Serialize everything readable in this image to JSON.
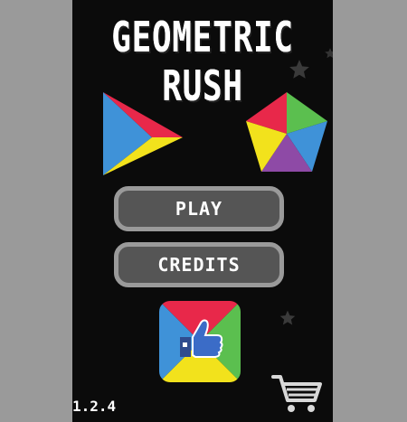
{
  "game": {
    "title_line1": "GEOMETRIC",
    "title_line2": "RUSH",
    "play_label": "PLAY",
    "credits_label": "CREDITS",
    "version": "1.2.4"
  },
  "icons": {
    "triangle": "triangle-logo-icon",
    "pentagon": "pentagon-logo-icon",
    "like": "facebook-like-icon",
    "cart": "shopping-cart-icon",
    "star": "star-icon"
  },
  "colors": {
    "red": "#e8284a",
    "blue": "#3f92d8",
    "yellow": "#f2e21c",
    "green": "#5bbf4f",
    "purple": "#8e4aa6",
    "button_bg": "#555555",
    "button_border": "#9a9a9a"
  }
}
